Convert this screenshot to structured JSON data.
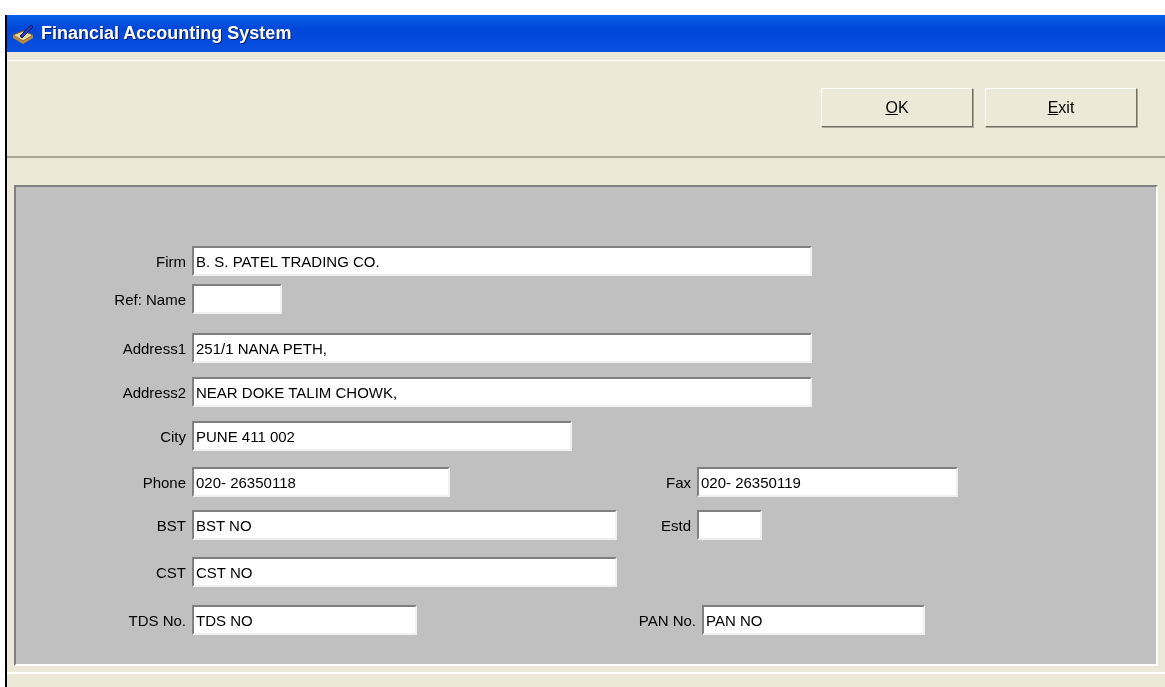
{
  "window": {
    "title": "Financial Accounting System"
  },
  "toolbar": {
    "buttons": [
      {
        "key": "O",
        "rest": "K"
      },
      {
        "key": "E",
        "rest": "xit"
      }
    ]
  },
  "form": {
    "rows": [
      {
        "fields": [
          {
            "label": "Firm",
            "value": "B. S. PATEL TRADING CO."
          }
        ]
      },
      {
        "fields": [
          {
            "label": "Ref: Name"
          }
        ]
      },
      {
        "fields": [
          {
            "label": "Address1",
            "value": "251/1 NANA PETH,"
          }
        ]
      },
      {
        "fields": [
          {
            "label": "Address2",
            "value": "NEAR DOKE TALIM CHOWK,"
          }
        ]
      },
      {
        "fields": [
          {
            "label": "City",
            "value": "PUNE 411 002"
          }
        ]
      },
      {
        "fields": [
          {
            "label": "Phone",
            "value": "020- 26350118"
          },
          {
            "label": "Fax",
            "value": "020- 26350119"
          }
        ]
      },
      {
        "fields": [
          {
            "label": "BST",
            "value": "BST NO"
          },
          {
            "label": "Estd"
          }
        ]
      },
      {
        "fields": [
          {
            "label": "CST",
            "value": "CST NO"
          }
        ]
      },
      {
        "fields": [
          {
            "label": "TDS No.",
            "value": "TDS NO"
          },
          {
            "label": "PAN No.",
            "value": "PAN NO"
          }
        ]
      }
    ]
  }
}
